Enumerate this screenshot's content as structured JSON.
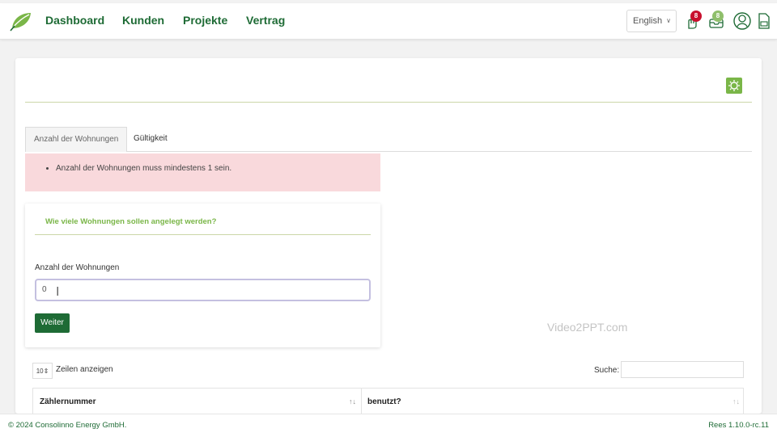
{
  "nav": {
    "items": [
      "Dashboard",
      "Kunden",
      "Projekte",
      "Vertrag"
    ],
    "language": "English",
    "notifications_count": "8",
    "messages_count": "8"
  },
  "tabs": [
    "Anzahl der Wohnungen",
    "Gültigkeit"
  ],
  "alert": {
    "message": "Anzahl der Wohnungen muss mindestens 1 sein."
  },
  "form": {
    "title": "Wie viele Wohnungen sollen angelegt werden?",
    "field_label": "Anzahl der Wohnungen",
    "field_value": "0",
    "submit_label": "Weiter"
  },
  "watermark": "Video2PPT.com",
  "table": {
    "page_length": "10",
    "length_label": "Zeilen anzeigen",
    "search_label": "Suche:",
    "columns": [
      "Zählernummer",
      "benutzt?"
    ]
  },
  "footer": {
    "copyright": "© 2024 Consolinno Energy GmbH.",
    "version": "Rees 1.10.0-rc.11"
  },
  "colors": {
    "brand_green": "#1e6b35",
    "accent_green": "#7ab648",
    "alert_bg": "#f9d9dc",
    "badge_red": "#c8102e",
    "badge_green": "#8fbf6b"
  }
}
